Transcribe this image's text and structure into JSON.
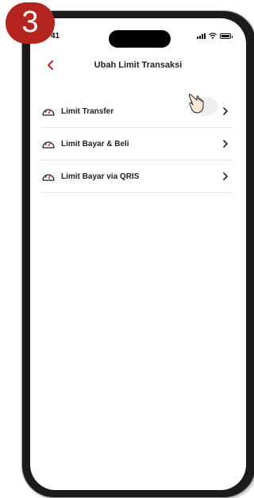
{
  "step_badge": "3",
  "status_bar": {
    "time": "41"
  },
  "header": {
    "title": "Ubah Limit Transaksi"
  },
  "menu": {
    "items": [
      {
        "label": "Limit Transfer"
      },
      {
        "label": "Limit Bayar & Beli"
      },
      {
        "label": "Limit Bayar via QRIS"
      }
    ]
  },
  "colors": {
    "accent": "#c7202a",
    "badge": "#b5251f"
  },
  "icons": {
    "item_icon": "speedometer-icon",
    "back_icon": "chevron-left-icon",
    "item_arrow": "chevron-right-icon",
    "pointer": "tap-hand-icon"
  }
}
